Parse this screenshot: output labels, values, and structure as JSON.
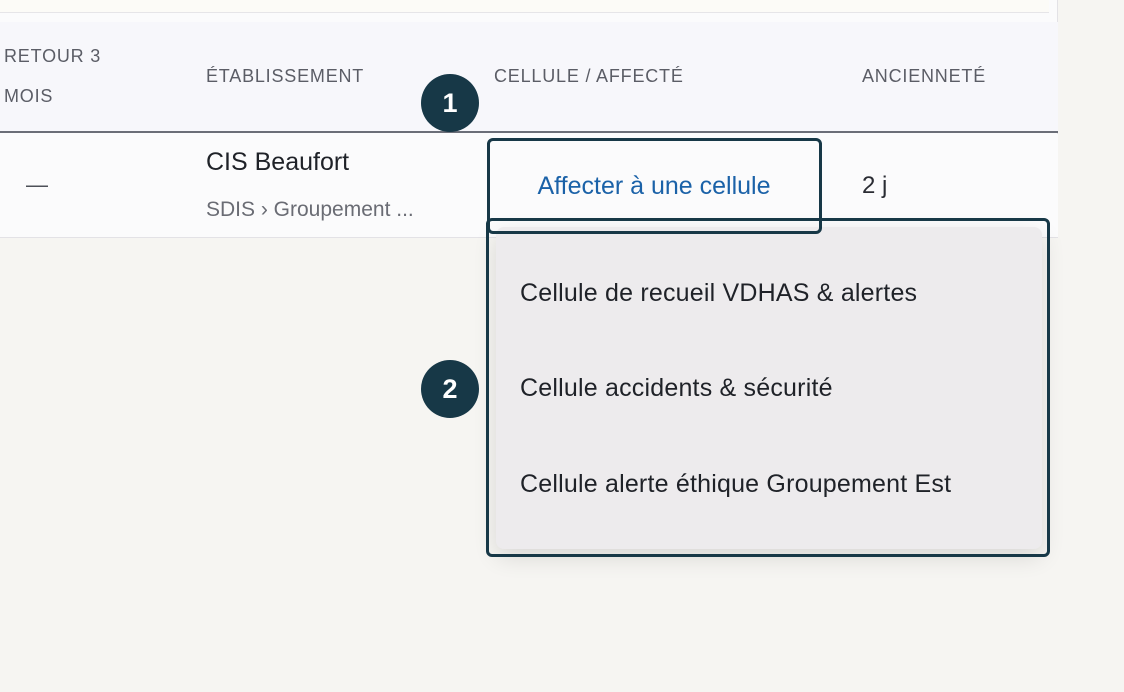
{
  "table": {
    "headers": {
      "retour": "RETOUR 3 MOIS",
      "etablissement": "ÉTABLISSEMENT",
      "cellule": "CELLULE / AFFECTÉ",
      "anciennete": "ANCIENNETÉ"
    },
    "rows": [
      {
        "retour": "—",
        "etablissement_name": "CIS Beaufort",
        "etablissement_path": "SDIS › Groupement ...",
        "cellule_action": "Affecter à une cellule",
        "anciennete": "2 j"
      }
    ]
  },
  "dropdown": {
    "options": [
      "Cellule de recueil VDHAS & alertes",
      "Cellule accidents & sécurité",
      "Cellule alerte éthique Groupement Est"
    ]
  },
  "annotations": {
    "marker_1": "1",
    "marker_2": "2"
  },
  "colors": {
    "accent_link": "#1b62a8",
    "annotation": "#173847",
    "background": "#f6f5f2"
  }
}
